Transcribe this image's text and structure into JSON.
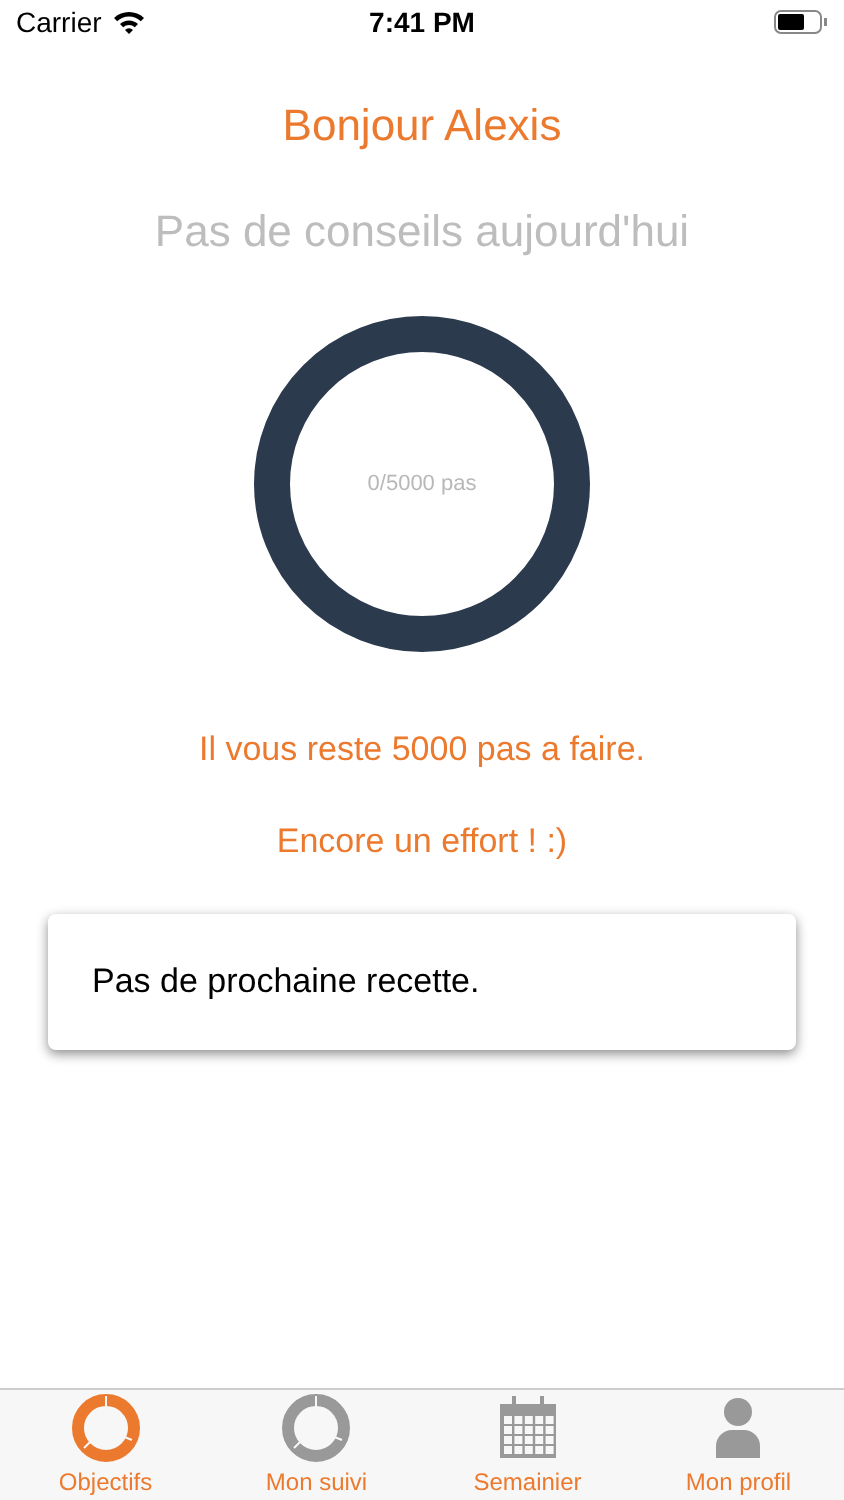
{
  "status_bar": {
    "carrier": "Carrier",
    "time": "7:41 PM"
  },
  "greeting": "Bonjour Alexis",
  "advice": "Pas de conseils aujourd'hui",
  "steps_ring": {
    "reading": "0/5000 pas"
  },
  "remaining": "Il vous reste 5000 pas a faire.",
  "encouragement": "Encore un effort ! :)",
  "recipe_card": {
    "text": "Pas de prochaine recette."
  },
  "tabs": [
    {
      "label": "Objectifs",
      "kind": "ring",
      "selected": true
    },
    {
      "label": "Mon suivi",
      "kind": "ring",
      "selected": false
    },
    {
      "label": "Semainier",
      "kind": "calendar",
      "selected": false
    },
    {
      "label": "Mon profil",
      "kind": "person",
      "selected": false
    }
  ]
}
